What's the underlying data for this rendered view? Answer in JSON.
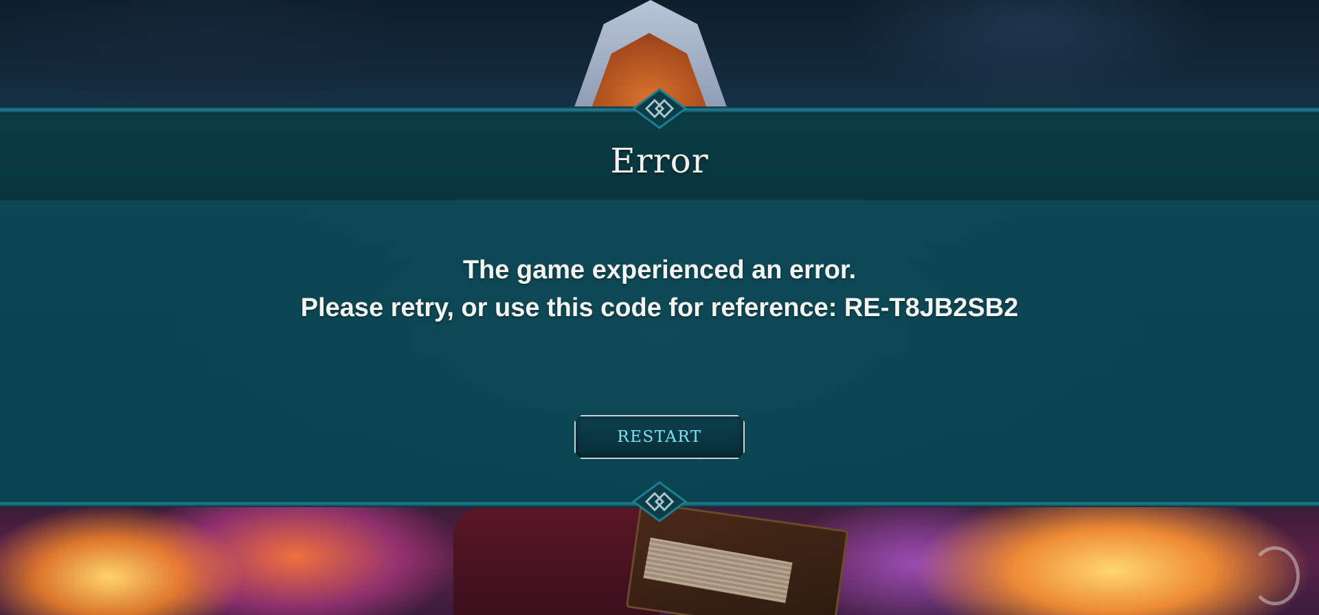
{
  "dialog": {
    "title": "Error",
    "message_line1": "The game experienced an error.",
    "message_line2": "Please retry, or use this code for reference: RE-T8JB2SB2",
    "restart_label": "RESTART"
  },
  "colors": {
    "panel": "#0b4551",
    "header_band": "#083640",
    "trim": "#1f7f92",
    "button_text": "#7fe3f0",
    "title_text": "#f3f1ea"
  },
  "icons": {
    "ornament_top": "diamond-ornament-icon",
    "ornament_bottom": "diamond-ornament-icon",
    "loading": "loading-spinner-icon"
  }
}
